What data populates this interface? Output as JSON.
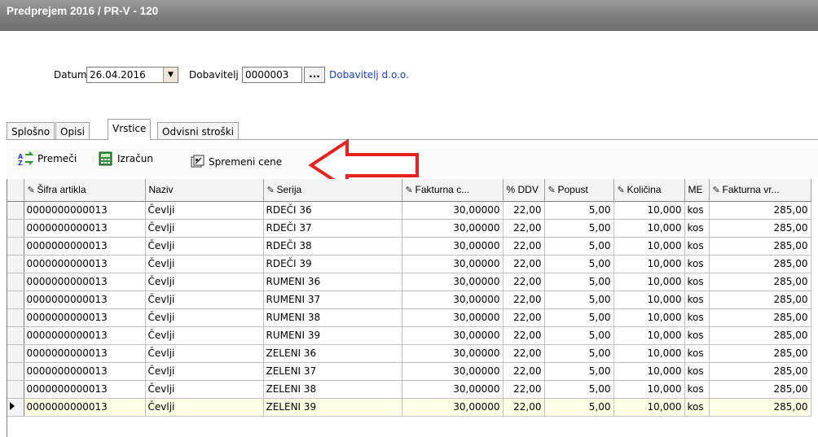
{
  "window": {
    "title": "Predprejem 2016 / PR-V - 120"
  },
  "header": {
    "date_label": "Datum",
    "date_value": "26.04.2016",
    "supplier_label": "Dobavitelj",
    "supplier_code": "0000003",
    "supplier_btn": "...",
    "supplier_name": "Dobavitelj d.o.o."
  },
  "tabs": [
    {
      "label": "Splošno",
      "active": false
    },
    {
      "label": "Opisi",
      "active": false
    },
    {
      "label": "Vrstice",
      "active": true
    },
    {
      "label": "Odvisni stroški",
      "active": false
    }
  ],
  "toolbar": {
    "move_label": "Premeči",
    "calc_label": "Izračun",
    "prices_label": "Spremeni cene"
  },
  "grid": {
    "columns": [
      "Šifra artikla",
      "Naziv",
      "Serija",
      "Fakturna c...",
      "% DDV",
      "Popust",
      "Količina",
      "ME",
      "Fakturna vr..."
    ],
    "rows": [
      [
        "0000000000013",
        "Čevlji",
        "RDEČI 36",
        "30,00000",
        "22,00",
        "5,00",
        "10,000",
        "kos",
        "285,00"
      ],
      [
        "0000000000013",
        "Čevlji",
        "RDEČI 37",
        "30,00000",
        "22,00",
        "5,00",
        "10,000",
        "kos",
        "285,00"
      ],
      [
        "0000000000013",
        "Čevlji",
        "RDEČI 38",
        "30,00000",
        "22,00",
        "5,00",
        "10,000",
        "kos",
        "285,00"
      ],
      [
        "0000000000013",
        "Čevlji",
        "RDEČI 39",
        "30,00000",
        "22,00",
        "5,00",
        "10,000",
        "kos",
        "285,00"
      ],
      [
        "0000000000013",
        "Čevlji",
        "RUMENI 36",
        "30,00000",
        "22,00",
        "5,00",
        "10,000",
        "kos",
        "285,00"
      ],
      [
        "0000000000013",
        "Čevlji",
        "RUMENI 37",
        "30,00000",
        "22,00",
        "5,00",
        "10,000",
        "kos",
        "285,00"
      ],
      [
        "0000000000013",
        "Čevlji",
        "RUMENI 38",
        "30,00000",
        "22,00",
        "5,00",
        "10,000",
        "kos",
        "285,00"
      ],
      [
        "0000000000013",
        "Čevlji",
        "RUMENI 39",
        "30,00000",
        "22,00",
        "5,00",
        "10,000",
        "kos",
        "285,00"
      ],
      [
        "0000000000013",
        "Čevlji",
        "ZELENI 36",
        "30,00000",
        "22,00",
        "5,00",
        "10,000",
        "kos",
        "285,00"
      ],
      [
        "0000000000013",
        "Čevlji",
        "ZELENI 37",
        "30,00000",
        "22,00",
        "5,00",
        "10,000",
        "kos",
        "285,00"
      ],
      [
        "0000000000013",
        "Čevlji",
        "ZELENI 38",
        "30,00000",
        "22,00",
        "5,00",
        "10,000",
        "kos",
        "285,00"
      ],
      [
        "0000000000013",
        "Čevlji",
        "ZELENI 39",
        "30,00000",
        "22,00",
        "5,00",
        "10,000",
        "kos",
        "285,00"
      ]
    ],
    "selected_row": 11
  },
  "icons": {
    "move": "move-icon",
    "calc": "calculator-icon",
    "prices": "price-change-icon",
    "arrow": "red-arrow-annotation-icon",
    "pencil": "pencil-icon"
  },
  "colors": {
    "title_bar": "#7a7a7a",
    "link": "#1a3cdc",
    "annotation": "#e8211d",
    "selected_row": "#ffffe6"
  }
}
